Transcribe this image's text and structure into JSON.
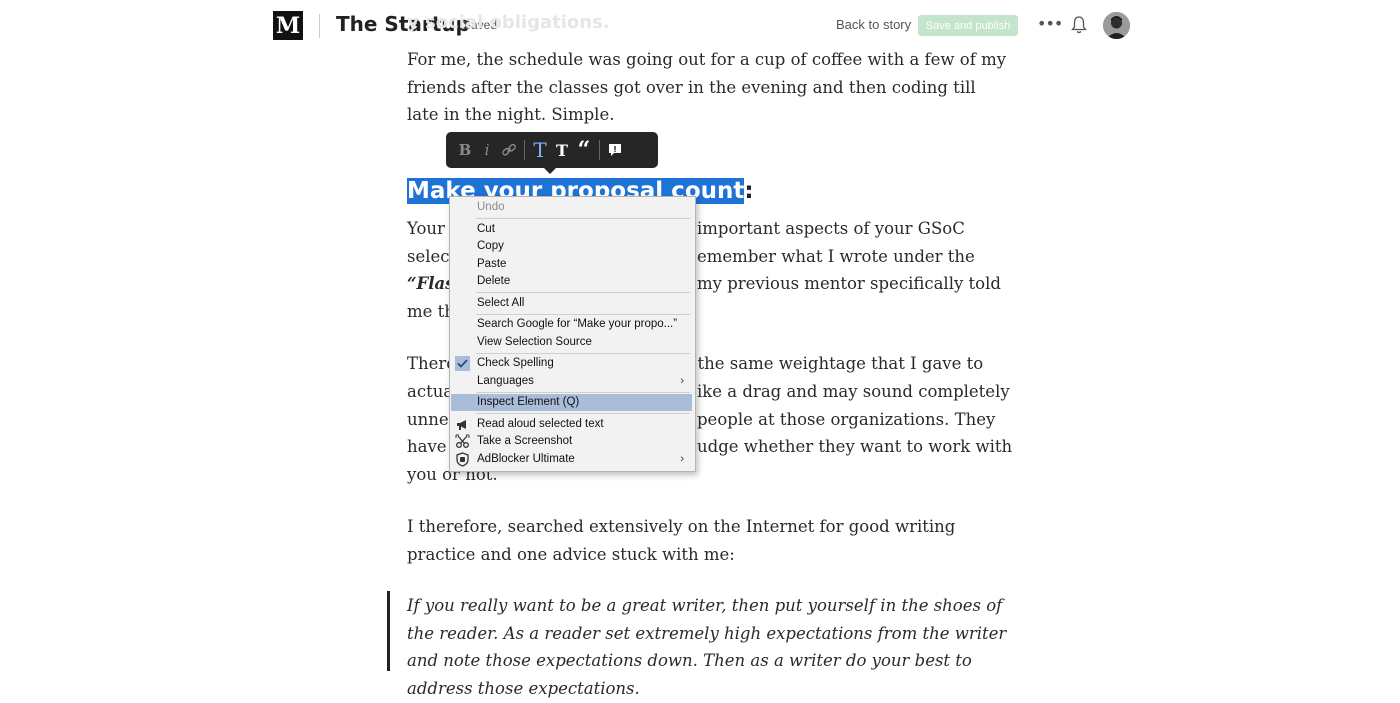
{
  "header": {
    "logo_letter": "M",
    "publication": "The Startup",
    "status": "Saved",
    "back_link": "Back to story",
    "publish_button": "Save and publish",
    "more_icon": "more-icon",
    "bell_icon": "notification-bell-icon"
  },
  "article": {
    "faded_line": "y social obligations.",
    "para1": "For me, the schedule was going out for a cup of coffee with a few of my friends after the classes got over in the evening and then coding till late in the night. Simple.",
    "heading": "Make your proposal count",
    "heading_tail": ":",
    "para2": [
      {
        "left": "Your C",
        "right": "important aspects of your GSoC"
      },
      {
        "left": "select",
        "right": "emember what I wrote under the"
      },
      {
        "left": "“Flash",
        "right": "my previous mentor specifically told"
      },
      {
        "left": "me th",
        "right": ""
      }
    ],
    "para3": [
      {
        "left": "There",
        "right": "l the same weightage that I gave to"
      },
      {
        "left": "actua",
        "right": "ike a drag and may sound completely"
      },
      {
        "left": "unnec",
        "right": "people at those organizations. They"
      },
      {
        "left": "have ",
        "right": "udge whether they want to work with"
      },
      {
        "left": "you or not.",
        "right": ""
      }
    ],
    "para4": "I therefore, searched extensively on the Internet for good writing practice and one advice stuck with me:",
    "quote": "If you really want to be a great writer, then put yourself in the shoes of the reader. As a reader set extremely high expectations from the writer and note those expectations down. Then as a writer do your best to address those expectations."
  },
  "format_toolbar": {
    "bold": "B",
    "italic": "i",
    "link_icon": "link-icon",
    "large_title": "T",
    "small_title": "T",
    "quote": "“",
    "comment_icon": "comment-icon"
  },
  "context_menu": {
    "items": [
      {
        "label": "Undo",
        "disabled": true
      },
      {
        "label": "Cut"
      },
      {
        "label": "Copy"
      },
      {
        "label": "Paste"
      },
      {
        "label": "Delete"
      },
      {
        "label": "Select All"
      },
      {
        "label": "Search Google for “Make your propo...”"
      },
      {
        "label": "View Selection Source"
      },
      {
        "label": "Check Spelling",
        "checked": true
      },
      {
        "label": "Languages",
        "submenu": true
      },
      {
        "label": "Inspect Element (Q)",
        "highlighted": true
      },
      {
        "label": "Read aloud selected text",
        "icon": "megaphone-icon"
      },
      {
        "label": "Take a Screenshot",
        "icon": "scissors-icon"
      },
      {
        "label": "AdBlocker Ultimate",
        "icon": "shield-icon",
        "submenu": true
      }
    ]
  },
  "colors": {
    "selection": "#1e73d6",
    "menu_highlight": "#a9bdd9",
    "publish_disabled": "#c5e4cc",
    "toolbar_bg": "#262626"
  }
}
